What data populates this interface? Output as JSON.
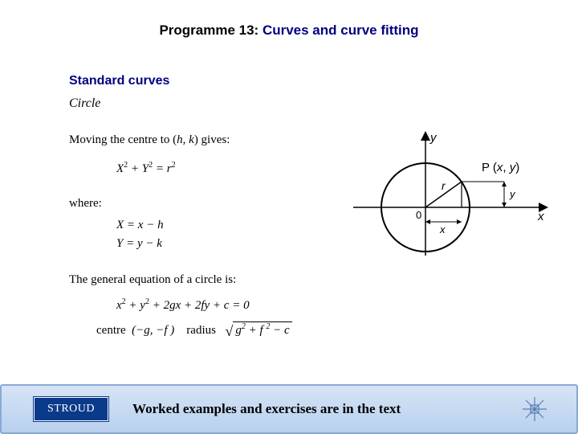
{
  "header": {
    "prefix": "Programme 13:  ",
    "title": "Curves and curve fitting"
  },
  "section": {
    "title": "Standard curves",
    "subtitle": "Circle"
  },
  "body": {
    "line1_a": "Moving the centre to (",
    "line1_h": "h",
    "line1_sep": ", ",
    "line1_k": "k",
    "line1_b": ") gives:",
    "eq1": "X² + Y² = r²",
    "where": "where:",
    "eq2a": "X = x − h",
    "eq2b": "Y = y − k",
    "line2": "The general equation of a circle is:",
    "eq3": "x² + y² + 2gx + 2fy + c = 0",
    "eq4_centre_label": "centre",
    "eq4_centre_val": "(−g, −f )",
    "eq4_radius_label": "radius",
    "eq4_radius_body": "g² + f ² − c"
  },
  "diagram": {
    "y_axis": "y",
    "x_axis": "x",
    "point_label": "P (x, y)",
    "r_label": "r",
    "x_small": "x",
    "y_small": "y",
    "origin": "0"
  },
  "footer": {
    "brand": "STROUD",
    "text": "Worked examples and exercises are in the text"
  }
}
